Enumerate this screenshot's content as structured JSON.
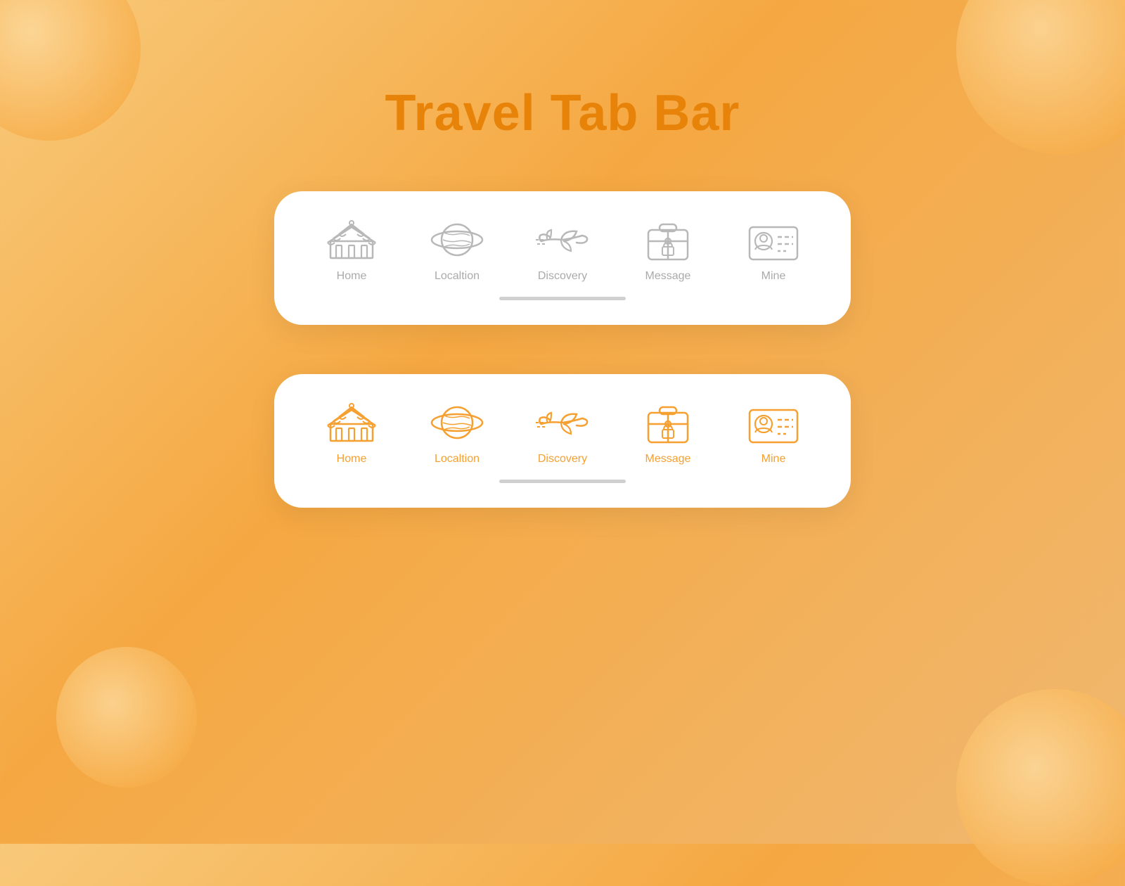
{
  "page": {
    "title": "Travel Tab Bar",
    "background_color": "#f5a842"
  },
  "tab_bars": [
    {
      "id": "inactive",
      "theme": "gray",
      "items": [
        {
          "id": "home",
          "label": "Home"
        },
        {
          "id": "location",
          "label": "Localtion"
        },
        {
          "id": "discovery",
          "label": "Discovery"
        },
        {
          "id": "message",
          "label": "Message"
        },
        {
          "id": "mine",
          "label": "Mine"
        }
      ]
    },
    {
      "id": "active",
      "theme": "orange",
      "items": [
        {
          "id": "home",
          "label": "Home"
        },
        {
          "id": "location",
          "label": "Localtion"
        },
        {
          "id": "discovery",
          "label": "Discovery"
        },
        {
          "id": "message",
          "label": "Message"
        },
        {
          "id": "mine",
          "label": "Mine"
        }
      ]
    }
  ]
}
